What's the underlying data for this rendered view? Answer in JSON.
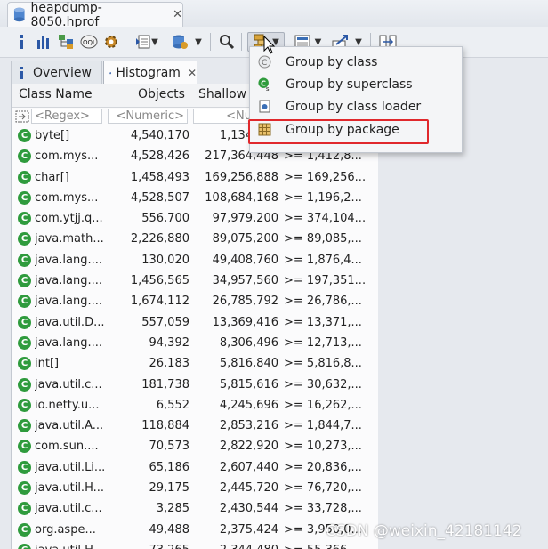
{
  "editor": {
    "tab_title": "heapdump-8050.hprof",
    "close_glyph": "✕"
  },
  "toolbar": {
    "icons": [
      "info-icon",
      "histogram-icon",
      "dominator-tree-icon",
      "oql-icon",
      "gear-icon",
      "run-report-icon",
      "query-browser-icon",
      "search-icon",
      "group-by-icon",
      "calculate-retained-icon",
      "export-icon",
      "compare-icon"
    ]
  },
  "view_tabs": {
    "overview": "Overview",
    "histogram": "Histogram",
    "close_glyph": "✕"
  },
  "table": {
    "headers": {
      "class_name": "Class Name",
      "objects": "Objects",
      "shallow": "Shallow I"
    },
    "filters": {
      "class_name": "<Regex>",
      "objects": "<Numeric>",
      "shallow": "<Numer"
    },
    "rows": [
      {
        "name": "byte[]",
        "objects": "4,540,170",
        "shallow": "1,134,826",
        "retained": ""
      },
      {
        "name": "com.mys...",
        "objects": "4,528,426",
        "shallow": "217,364,448",
        "retained": ">= 1,412,8..."
      },
      {
        "name": "char[]",
        "objects": "1,458,493",
        "shallow": "169,256,888",
        "retained": ">= 169,256..."
      },
      {
        "name": "com.mys...",
        "objects": "4,528,507",
        "shallow": "108,684,168",
        "retained": ">= 1,196,2..."
      },
      {
        "name": "com.ytjj.q...",
        "objects": "556,700",
        "shallow": "97,979,200",
        "retained": ">= 374,104..."
      },
      {
        "name": "java.math...",
        "objects": "2,226,880",
        "shallow": "89,075,200",
        "retained": ">= 89,085,..."
      },
      {
        "name": "java.lang....",
        "objects": "130,020",
        "shallow": "49,408,760",
        "retained": ">= 1,876,4..."
      },
      {
        "name": "java.lang....",
        "objects": "1,456,565",
        "shallow": "34,957,560",
        "retained": ">= 197,351..."
      },
      {
        "name": "java.lang....",
        "objects": "1,674,112",
        "shallow": "26,785,792",
        "retained": ">= 26,786,..."
      },
      {
        "name": "java.util.D...",
        "objects": "557,059",
        "shallow": "13,369,416",
        "retained": ">= 13,371,..."
      },
      {
        "name": "java.lang....",
        "objects": "94,392",
        "shallow": "8,306,496",
        "retained": ">= 12,713,..."
      },
      {
        "name": "int[]",
        "objects": "26,183",
        "shallow": "5,816,840",
        "retained": ">= 5,816,8..."
      },
      {
        "name": "java.util.c...",
        "objects": "181,738",
        "shallow": "5,815,616",
        "retained": ">= 30,632,..."
      },
      {
        "name": "io.netty.u...",
        "objects": "6,552",
        "shallow": "4,245,696",
        "retained": ">= 16,262,..."
      },
      {
        "name": "java.util.A...",
        "objects": "118,884",
        "shallow": "2,853,216",
        "retained": ">= 1,844,7..."
      },
      {
        "name": "com.sun....",
        "objects": "70,573",
        "shallow": "2,822,920",
        "retained": ">= 10,273,..."
      },
      {
        "name": "java.util.Li...",
        "objects": "65,186",
        "shallow": "2,607,440",
        "retained": ">= 20,836,..."
      },
      {
        "name": "java.util.H...",
        "objects": "29,175",
        "shallow": "2,445,720",
        "retained": ">= 76,720,..."
      },
      {
        "name": "java.util.c...",
        "objects": "3,285",
        "shallow": "2,430,544",
        "retained": ">= 33,728,..."
      },
      {
        "name": "org.aspe...",
        "objects": "49,488",
        "shallow": "2,375,424",
        "retained": ">= 3,950,0..."
      },
      {
        "name": "java.util.H...",
        "objects": "73,265",
        "shallow": "2,344,480",
        "retained": ">= 55,366,..."
      }
    ]
  },
  "menu": {
    "items": [
      {
        "label": "Group by class",
        "icon": "class-circle-icon"
      },
      {
        "label": "Group by superclass",
        "icon": "superclass-icon"
      },
      {
        "label": "Group by class loader",
        "icon": "class-loader-icon"
      },
      {
        "label": "Group by package",
        "icon": "package-icon"
      }
    ],
    "highlight_color": "#e0282c"
  },
  "watermark": "CSDN @weixin_42181142"
}
